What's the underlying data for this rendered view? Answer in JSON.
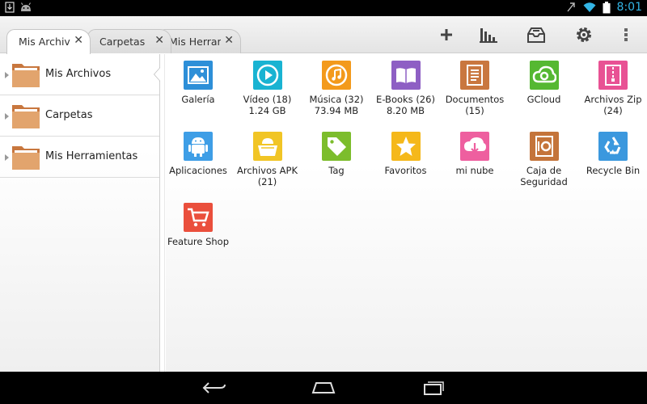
{
  "status": {
    "time": "8:01"
  },
  "tabs": [
    {
      "label": "Mis Archivos",
      "close": "✕"
    },
    {
      "label": "Carpetas",
      "close": "✕"
    },
    {
      "label": "Mis Herramientas",
      "close": "✕"
    }
  ],
  "sidebar": {
    "items": [
      {
        "label": "Mis Archivos"
      },
      {
        "label": "Carpetas"
      },
      {
        "label": "Mis Herramientas"
      }
    ]
  },
  "grid": {
    "items": [
      {
        "name": "galeria",
        "label": "Galería",
        "sub": "",
        "color": "#2d8fd8",
        "icon": "image-icon"
      },
      {
        "name": "video",
        "label": "Vídeo (18)",
        "sub": "1.24 GB",
        "color": "#19b3d2",
        "icon": "play-icon"
      },
      {
        "name": "musica",
        "label": "Música (32)",
        "sub": "73.94 MB",
        "color": "#f39a1c",
        "icon": "music-note-icon"
      },
      {
        "name": "ebooks",
        "label": "E-Books (26)",
        "sub": "8.20 MB",
        "color": "#8e5fc4",
        "icon": "book-icon"
      },
      {
        "name": "documentos",
        "label": "Documentos",
        "sub": "(15)",
        "color": "#c9773f",
        "icon": "document-icon"
      },
      {
        "name": "gcloud",
        "label": "GCloud",
        "sub": "",
        "color": "#55b832",
        "icon": "cloud-icon"
      },
      {
        "name": "archivos-zip",
        "label": "Archivos Zip",
        "sub": "(24)",
        "color": "#e85294",
        "icon": "zip-icon"
      },
      {
        "name": "aplicaciones",
        "label": "Aplicaciones",
        "sub": "",
        "color": "#3e9ee6",
        "icon": "android-icon"
      },
      {
        "name": "archivos-apk",
        "label": "Archivos APK",
        "sub": "(21)",
        "color": "#f1c525",
        "icon": "android-box-icon"
      },
      {
        "name": "tag",
        "label": "Tag",
        "sub": "",
        "color": "#7cbd2c",
        "icon": "tag-icon"
      },
      {
        "name": "favoritos",
        "label": "Favoritos",
        "sub": "",
        "color": "#f5b81a",
        "icon": "star-icon"
      },
      {
        "name": "mi-nube",
        "label": "mi nube",
        "sub": "",
        "color": "#ee5f9f",
        "icon": "cloud-download-icon"
      },
      {
        "name": "caja-seguridad",
        "label": "Caja de",
        "sub": "Seguridad",
        "color": "#c4743a",
        "icon": "safe-icon"
      },
      {
        "name": "recycle-bin",
        "label": "Recycle Bin",
        "sub": "",
        "color": "#3b98de",
        "icon": "recycle-icon"
      },
      {
        "name": "feature-shop",
        "label": "Feature Shop",
        "sub": "",
        "color": "#ea4f3c",
        "icon": "cart-icon"
      }
    ]
  }
}
